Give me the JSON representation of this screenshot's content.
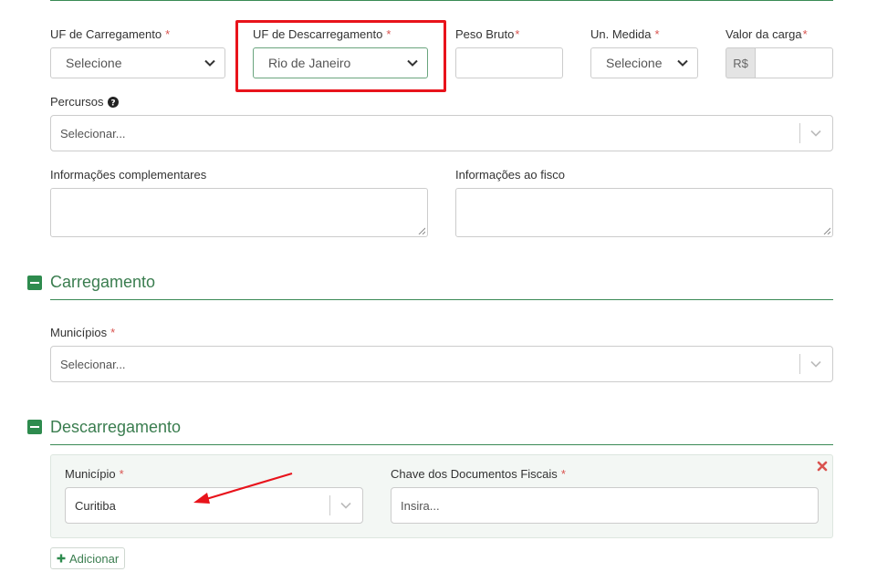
{
  "row1": {
    "uf_carregamento": {
      "label": "UF de Carregamento",
      "required": "*",
      "value": "Selecione"
    },
    "uf_descarregamento": {
      "label": "UF de Descarregamento",
      "required": "*",
      "value": "Rio de Janeiro"
    },
    "peso_bruto": {
      "label": "Peso Bruto",
      "required": "*",
      "value": ""
    },
    "un_medida": {
      "label": "Un. Medida",
      "required": "*",
      "value": "Selecione"
    },
    "valor_carga": {
      "label": "Valor da carga",
      "required": "*",
      "prefix": "R$",
      "value": ""
    }
  },
  "percursos": {
    "label": "Percursos",
    "help_icon": "question-circle-icon",
    "placeholder": "Selecionar..."
  },
  "info_complementares": {
    "label": "Informações complementares",
    "value": ""
  },
  "info_fisco": {
    "label": "Informações ao fisco",
    "value": ""
  },
  "carregamento": {
    "title": "Carregamento",
    "icon": "minus-square-icon",
    "municipios": {
      "label": "Municípios",
      "required": "*",
      "placeholder": "Selecionar..."
    }
  },
  "descarregamento": {
    "title": "Descarregamento",
    "icon": "minus-square-icon",
    "municipio": {
      "label": "Município",
      "required": "*",
      "value": "Curitiba"
    },
    "chave": {
      "label": "Chave dos Documentos Fiscais",
      "required": "*",
      "placeholder": "Insira..."
    },
    "remove_icon": "close-icon",
    "add_button": {
      "label": "Adicionar",
      "icon": "plus-icon"
    }
  },
  "colors": {
    "accent": "#3a7d4f",
    "highlight_box": "#e8131b",
    "annotation_arrow": "#e8131b",
    "panel_bg": "#f3f7f4",
    "remove_icon": "#d9534f"
  }
}
